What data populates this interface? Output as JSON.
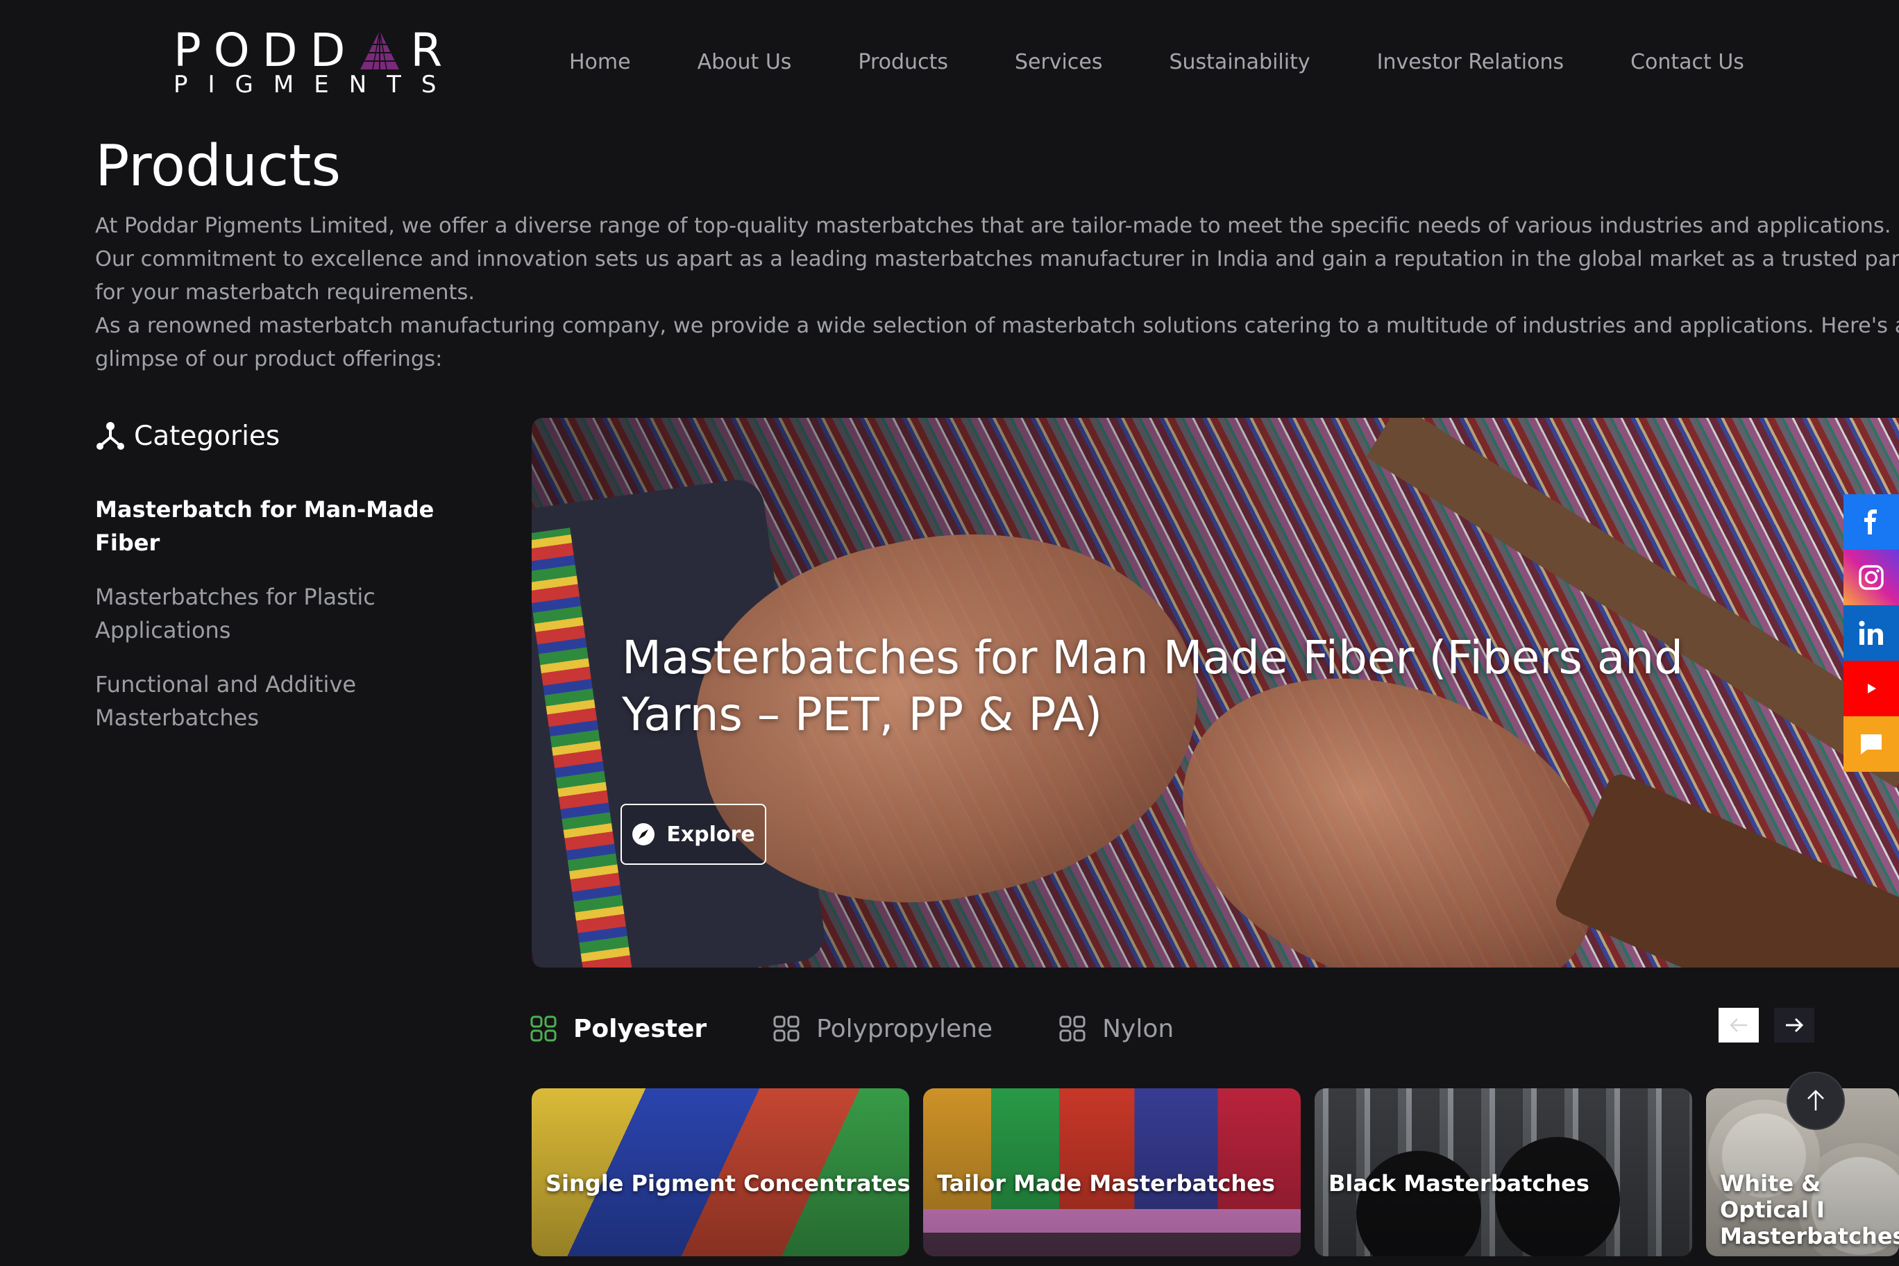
{
  "brand": {
    "logo_top_left": "PODD",
    "logo_top_right": "R",
    "logo_bottom": "PIGMENTS",
    "logo_colors": {
      "triangle": "#7a2a7a"
    }
  },
  "nav": {
    "items": [
      {
        "label": "Home"
      },
      {
        "label": "About Us"
      },
      {
        "label": "Products"
      },
      {
        "label": "Services"
      },
      {
        "label": "Sustainability"
      },
      {
        "label": "Investor Relations"
      },
      {
        "label": "Contact Us"
      }
    ]
  },
  "page": {
    "title": "Products",
    "intro": [
      "At Poddar Pigments Limited, we offer a diverse range of top-quality masterbatches that are tailor-made to meet the specific needs of various industries and applications.",
      "Our commitment to excellence and innovation sets us apart as a leading masterbatches manufacturer in India and gain a reputation in the global market as a trusted partner",
      "for your masterbatch requirements.",
      "As a renowned masterbatch manufacturing company, we provide a wide selection of masterbatch solutions catering to a multitude of industries and applications. Here's a",
      "glimpse of our product offerings:"
    ]
  },
  "sidebar": {
    "heading": "Categories",
    "heading_icon": "sitemap-icon",
    "items": [
      {
        "label": "Masterbatch for Man-Made Fiber",
        "active": true
      },
      {
        "label": "Masterbatches for Plastic Applications",
        "active": false
      },
      {
        "label": "Functional and Additive Masterbatches",
        "active": false
      }
    ]
  },
  "hero": {
    "title": "Masterbatches for Man Made Fiber (Fibers and Yarns – PET, PP & PA)",
    "button_label": "Explore",
    "button_icon": "compass-icon"
  },
  "social": {
    "items": [
      {
        "name": "facebook-icon",
        "color": "#1877f2"
      },
      {
        "name": "instagram-icon",
        "color": "#d6249f"
      },
      {
        "name": "linkedin-icon",
        "color": "#0a66c2"
      },
      {
        "name": "youtube-icon",
        "color": "#ff0000"
      },
      {
        "name": "chat-icon",
        "color": "#f7a21b"
      }
    ]
  },
  "tabs": {
    "items": [
      {
        "label": "Polyester",
        "active": true
      },
      {
        "label": "Polypropylene",
        "active": false
      },
      {
        "label": "Nylon",
        "active": false
      }
    ],
    "active_icon_color": "#4caf50"
  },
  "cards": {
    "items": [
      {
        "label": "Single Pigment Concentrates"
      },
      {
        "label": "Tailor Made Masterbatches"
      },
      {
        "label": "Black Masterbatches"
      },
      {
        "label_line1": "White & Optical I",
        "label_line2": "Masterbatches"
      }
    ]
  },
  "colors": {
    "background": "#131316",
    "nav_text": "#a5a7ad",
    "body_text": "#a0a2a8"
  }
}
